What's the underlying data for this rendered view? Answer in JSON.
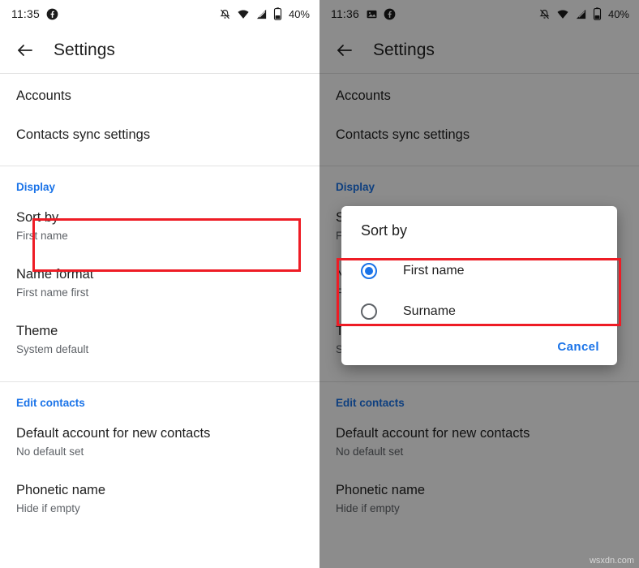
{
  "left": {
    "status": {
      "time": "11:35",
      "icons_left": [
        "facebook-icon"
      ],
      "icons_right": [
        "notifications-off-icon",
        "wifi-icon",
        "signal-icon",
        "battery-icon"
      ],
      "battery": "40%"
    },
    "appbar": {
      "title": "Settings",
      "back": "back-arrow"
    },
    "rows": [
      {
        "primary": "Accounts",
        "secondary": ""
      },
      {
        "primary": "Contacts sync settings",
        "secondary": ""
      }
    ],
    "display_section": {
      "header": "Display",
      "rows": [
        {
          "primary": "Sort by",
          "secondary": "First name"
        },
        {
          "primary": "Name format",
          "secondary": "First name first"
        },
        {
          "primary": "Theme",
          "secondary": "System default"
        }
      ]
    },
    "edit_section": {
      "header": "Edit contacts",
      "rows": [
        {
          "primary": "Default account for new contacts",
          "secondary": "No default set"
        },
        {
          "primary": "Phonetic name",
          "secondary": "Hide if empty"
        }
      ]
    }
  },
  "right": {
    "status": {
      "time": "11:36",
      "icons_left": [
        "image-icon",
        "facebook-icon"
      ],
      "icons_right": [
        "notifications-off-icon",
        "wifi-icon",
        "signal-icon",
        "battery-icon"
      ],
      "battery": "40%"
    },
    "appbar": {
      "title": "Settings",
      "back": "back-arrow"
    },
    "rows": [
      {
        "primary": "Accounts",
        "secondary": ""
      },
      {
        "primary": "Contacts sync settings",
        "secondary": ""
      }
    ],
    "display_section": {
      "header": "Display",
      "rows": [
        {
          "primary": "Sort by",
          "secondary": "First name"
        },
        {
          "primary": "Name format",
          "secondary": "First name first"
        },
        {
          "primary": "Theme",
          "secondary": "System default"
        }
      ]
    },
    "edit_section": {
      "header": "Edit contacts",
      "rows": [
        {
          "primary": "Default account for new contacts",
          "secondary": "No default set"
        },
        {
          "primary": "Phonetic name",
          "secondary": "Hide if empty"
        }
      ]
    },
    "dialog": {
      "title": "Sort by",
      "options": [
        {
          "label": "First name",
          "selected": true
        },
        {
          "label": "Surname",
          "selected": false
        }
      ],
      "cancel": "Cancel"
    }
  },
  "accent": "#1a73e8",
  "highlight_color": "#ee1c25",
  "watermark": "wsxdn.com"
}
